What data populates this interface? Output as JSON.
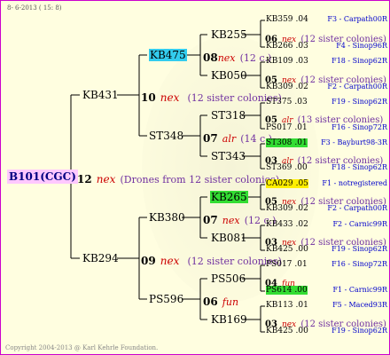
{
  "header": {
    "date_text": "8- 6-2013 ( 15: 8)"
  },
  "root": {
    "label": "B101(CGC)",
    "gen": "12",
    "mark": "nex",
    "note": "(Drones from 12 sister colonies)"
  },
  "level1": [
    {
      "label": "KB431",
      "gen": "10",
      "mark": "nex",
      "note": "(12 sister colonies)"
    },
    {
      "label": "KB294",
      "gen": "09",
      "mark": "nex",
      "note": "(12 sister colonies)"
    }
  ],
  "level2": [
    {
      "label": "KB475",
      "gen": "08",
      "mark": "nex",
      "note": "(12 c.)"
    },
    {
      "label": "ST348",
      "gen": "07",
      "mark": "alr",
      "note": "(14 c.)"
    },
    {
      "label": "KB380",
      "gen": "07",
      "mark": "nex",
      "note": "(12 c.)"
    },
    {
      "label": "PS596",
      "gen": "06",
      "mark": "fun",
      "note": ""
    }
  ],
  "level3": [
    "KB255",
    "KB050",
    "ST318",
    "ST343",
    "KB265",
    "KB081",
    "PS506",
    "KB169"
  ],
  "level3_mid": [
    {
      "gen": "06",
      "mark": "nex",
      "note": "(12 sister colonies)"
    },
    {
      "gen": "05",
      "mark": "nex",
      "note": "(12 sister colonies)"
    },
    {
      "gen": "05",
      "mark": "alr",
      "note": "(13 sister colonies)"
    },
    {
      "gen": "03",
      "mark": "alr",
      "note": "(12 sister colonies)"
    },
    {
      "gen": "05",
      "mark": "nex",
      "note": "(12 sister colonies)"
    },
    {
      "gen": "03",
      "mark": "nex",
      "note": "(12 sister colonies)"
    },
    {
      "gen": "04",
      "mark": "fun",
      "note": ""
    },
    {
      "gen": "03",
      "mark": "nex",
      "note": "(12 sister colonies)"
    }
  ],
  "leaves": [
    {
      "id": "KB359",
      "num": ".04",
      "rt": "F3 - Carpath00R"
    },
    {
      "id": "KB266",
      "num": ".03",
      "rt": "F4 - Sinop96R"
    },
    {
      "id": "KB109",
      "num": ".03",
      "rt": "F18 - Sinop62R"
    },
    {
      "id": "KB309",
      "num": ".02",
      "rt": "F2 - Carpath00R"
    },
    {
      "id": "ST375",
      "num": ".03",
      "rt": "F19 - Sinop62R"
    },
    {
      "id": "PS017",
      "num": ".01",
      "rt": "F16 - Sinop72R"
    },
    {
      "id": "ST308",
      "num": ".01",
      "rt": "F3 - Bayburt98-3R"
    },
    {
      "id": "ST369",
      "num": ".00",
      "rt": "F18 - Sinop62R"
    },
    {
      "id": "CA029",
      "num": ".05",
      "rt": "F1 - notregistered"
    },
    {
      "id": "KB309",
      "num": ".02",
      "rt": "F2 - Carpath00R"
    },
    {
      "id": "KB433",
      "num": ".02",
      "rt": "F2 - Carnic99R"
    },
    {
      "id": "KB425",
      "num": ".00",
      "rt": "F19 - Sinop62R"
    },
    {
      "id": "PS017",
      "num": ".01",
      "rt": "F16 - Sinop72R"
    },
    {
      "id": "PS614",
      "num": ".00",
      "rt": "F1 - Carnic99R"
    },
    {
      "id": "KB113",
      "num": ".01",
      "rt": "F5 - Maced93R"
    },
    {
      "id": "KB425",
      "num": ".00",
      "rt": "F19 - Sinop62R"
    }
  ],
  "footer": {
    "copyright": "Copyright 2004-2013 @ Karl Kehrle Foundation."
  }
}
